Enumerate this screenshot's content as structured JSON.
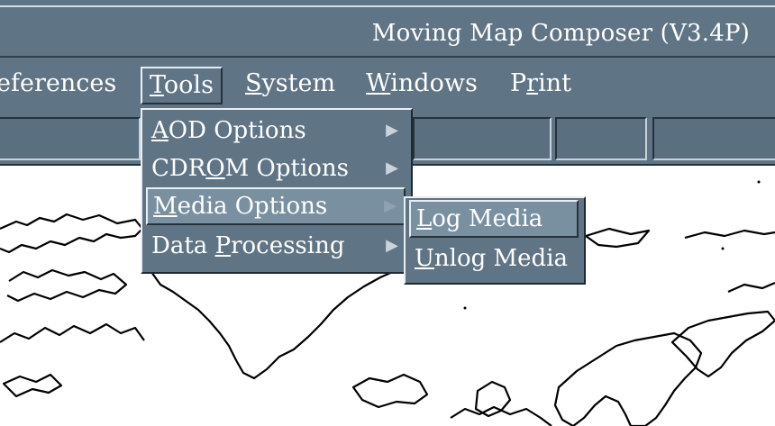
{
  "window": {
    "title": "Moving Map Composer  (V3.4P)"
  },
  "menubar": {
    "items": [
      {
        "label": "eferences"
      },
      {
        "label": "Tools",
        "underline": "T",
        "rest": "ools"
      },
      {
        "label": "System",
        "underline": "S",
        "rest": "ystem"
      },
      {
        "label": "Windows",
        "underline": "W",
        "rest": "indows"
      },
      {
        "label": "Print",
        "before": "P",
        "underline": "r",
        "rest": "int"
      }
    ]
  },
  "tools_menu": {
    "items": [
      {
        "before": "",
        "underline": "A",
        "rest": "OD Options",
        "submenu": true
      },
      {
        "before": "CDR",
        "underline": "O",
        "rest": "M  Options",
        "submenu": true
      },
      {
        "before": "",
        "underline": "M",
        "rest": "edia Options",
        "submenu": true,
        "selected": true
      },
      {
        "before": "Data ",
        "underline": "P",
        "rest": "rocessing",
        "submenu": true
      }
    ]
  },
  "media_submenu": {
    "items": [
      {
        "underline": "L",
        "rest": "og Media",
        "selected": true
      },
      {
        "underline": "U",
        "rest": "nlog Media"
      }
    ]
  },
  "icons": {
    "submenu_arrow": "▶"
  }
}
